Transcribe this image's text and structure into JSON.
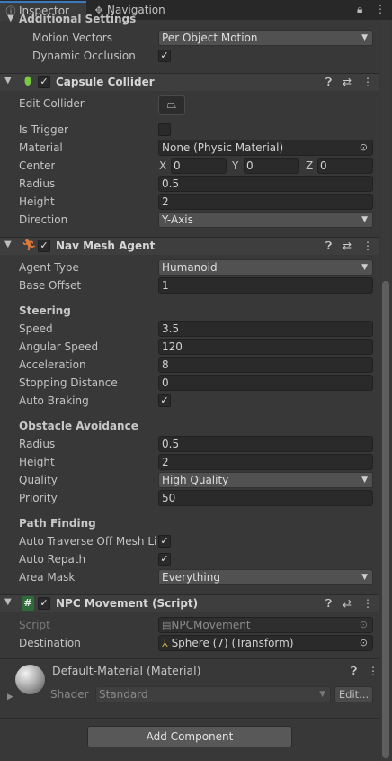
{
  "tabs": [
    {
      "label": "Inspector",
      "icon": "info-icon"
    },
    {
      "label": "Navigation",
      "icon": "navigation-icon"
    }
  ],
  "additional_settings": {
    "title": "Additional Settings",
    "motion_vectors": {
      "label": "Motion Vectors",
      "value": "Per Object Motion"
    },
    "dynamic_occlusion": {
      "label": "Dynamic Occlusion",
      "checked": true
    }
  },
  "capsule_collider": {
    "title": "Capsule Collider",
    "enabled": true,
    "edit_collider": "Edit Collider",
    "is_trigger": {
      "label": "Is Trigger",
      "checked": false
    },
    "material": {
      "label": "Material",
      "value": "None (Physic Material)"
    },
    "center": {
      "label": "Center",
      "x_label": "X",
      "x": "0",
      "y_label": "Y",
      "y": "0",
      "z_label": "Z",
      "z": "0"
    },
    "radius": {
      "label": "Radius",
      "value": "0.5"
    },
    "height": {
      "label": "Height",
      "value": "2"
    },
    "direction": {
      "label": "Direction",
      "value": "Y-Axis"
    }
  },
  "nav_mesh_agent": {
    "title": "Nav Mesh Agent",
    "enabled": true,
    "agent_type": {
      "label": "Agent Type",
      "value": "Humanoid"
    },
    "base_offset": {
      "label": "Base Offset",
      "value": "1"
    },
    "steering_title": "Steering",
    "speed": {
      "label": "Speed",
      "value": "3.5"
    },
    "angular_speed": {
      "label": "Angular Speed",
      "value": "120"
    },
    "acceleration": {
      "label": "Acceleration",
      "value": "8"
    },
    "stopping_distance": {
      "label": "Stopping Distance",
      "value": "0"
    },
    "auto_braking": {
      "label": "Auto Braking",
      "checked": true
    },
    "obstacle_title": "Obstacle Avoidance",
    "radius": {
      "label": "Radius",
      "value": "0.5"
    },
    "height": {
      "label": "Height",
      "value": "2"
    },
    "quality": {
      "label": "Quality",
      "value": "High Quality"
    },
    "priority": {
      "label": "Priority",
      "value": "50"
    },
    "path_title": "Path Finding",
    "auto_traverse": {
      "label": "Auto Traverse Off Mesh Lin",
      "checked": true
    },
    "auto_repath": {
      "label": "Auto Repath",
      "checked": true
    },
    "area_mask": {
      "label": "Area Mask",
      "value": "Everything"
    }
  },
  "npc_movement": {
    "title": "NPC Movement (Script)",
    "enabled": true,
    "script": {
      "label": "Script",
      "value": "NPCMovement"
    },
    "destination": {
      "label": "Destination",
      "value": "Sphere (7) (Transform)"
    }
  },
  "material": {
    "name": "Default-Material (Material)",
    "shader_label": "Shader",
    "shader_value": "Standard",
    "edit_label": "Edit..."
  },
  "add_component_label": "Add Component",
  "colors": {
    "background": "#383838",
    "header": "#3e3e3e",
    "tab_accent": "#3a79bb",
    "field": "#2a2a2a"
  }
}
